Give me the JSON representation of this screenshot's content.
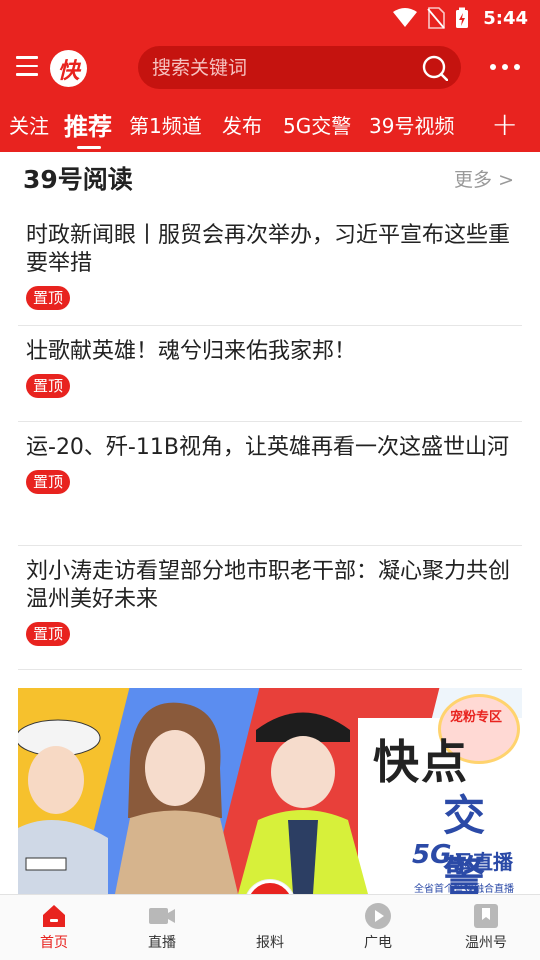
{
  "status_bar": {
    "time": "5:44"
  },
  "header": {
    "logo_text": "快",
    "search_placeholder": "搜索关键词"
  },
  "tabs": [
    "关注",
    "推荐",
    "第1频道",
    "发布",
    "5G交警",
    "39号视频"
  ],
  "active_tab": "推荐",
  "section": {
    "title": "39号阅读",
    "more": "更多 >"
  },
  "news": [
    {
      "title": "时政新闻眼丨服贸会再次举办，习近平宣布这些重要举措",
      "badge": "置顶"
    },
    {
      "title": "壮歌献英雄！魂兮归来佑我家邦！",
      "badge": "置顶"
    },
    {
      "title": "运-20、歼-11B视角，让英雄再看一次这盛世山河",
      "badge": "置顶"
    },
    {
      "title": "刘小涛走访看望部分地市职老干部：凝心聚力共创温州美好未来",
      "badge": "置顶"
    }
  ],
  "banner": {
    "big_text_1": "快点",
    "big_text_2": "交警",
    "tag_5g": "5G",
    "live_text": "云直播",
    "sub_text": "全省首个警媒融合直播",
    "badge_text": "宠粉专区"
  },
  "bottom_nav": [
    {
      "label": "首页",
      "icon": "home-icon"
    },
    {
      "label": "直播",
      "icon": "video-camera-icon"
    },
    {
      "label": "报料",
      "icon": "camera-icon"
    },
    {
      "label": "广电",
      "icon": "play-icon"
    },
    {
      "label": "温州号",
      "icon": "bookmark-icon"
    }
  ],
  "colors": {
    "brand_red": "#e8231f",
    "search_bg": "#c5130f"
  }
}
